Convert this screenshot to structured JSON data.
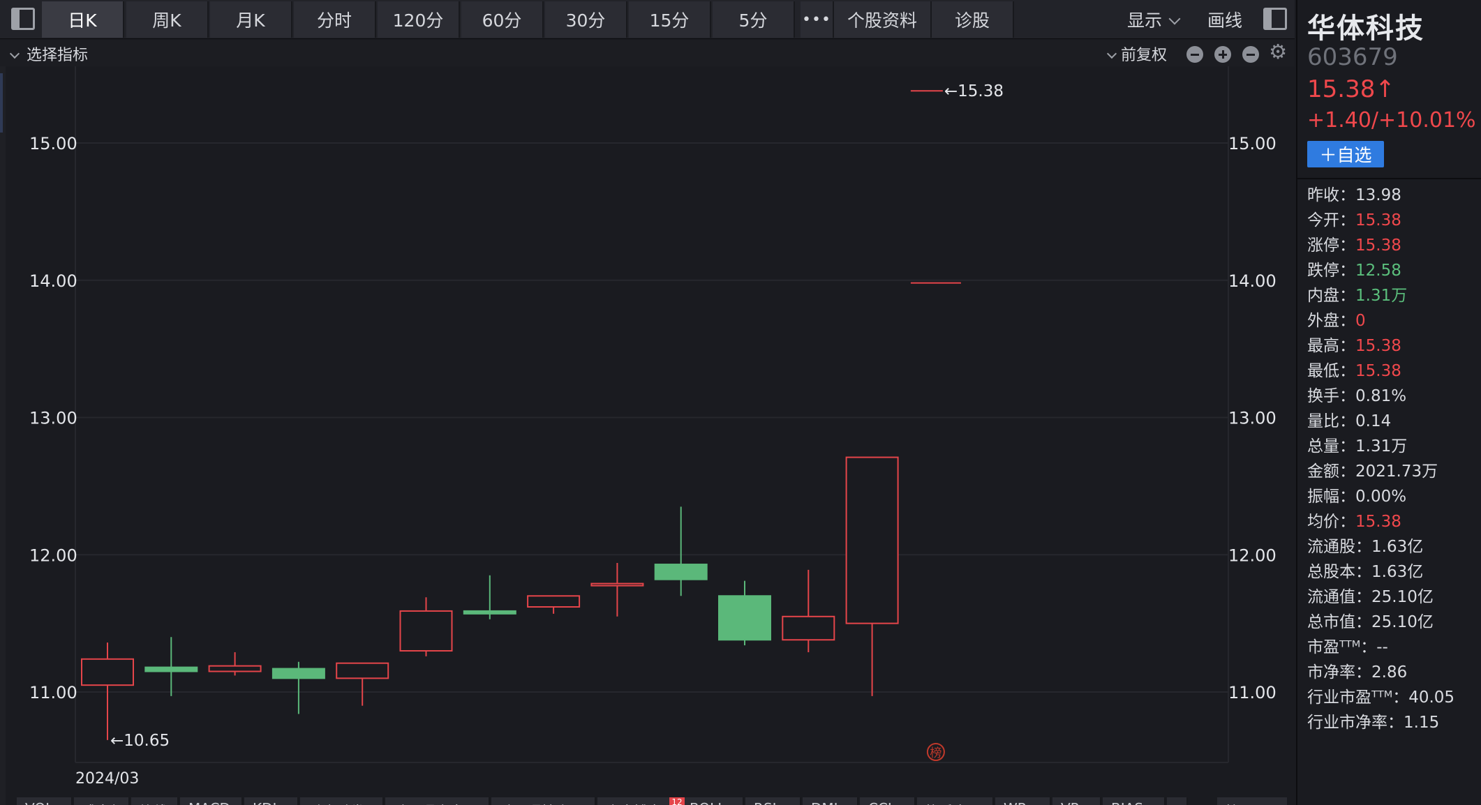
{
  "toolbar": {
    "periods": [
      {
        "label": "日K",
        "active": true
      },
      {
        "label": "周K",
        "active": false
      },
      {
        "label": "月K",
        "active": false
      },
      {
        "label": "分时",
        "active": false
      },
      {
        "label": "120分",
        "active": false
      },
      {
        "label": "60分",
        "active": false
      },
      {
        "label": "30分",
        "active": false
      },
      {
        "label": "15分",
        "active": false
      },
      {
        "label": "5分",
        "active": false
      }
    ],
    "more_label": "•••",
    "profile_label": "个股资料",
    "diagnose_label": "诊股",
    "display_label": "显示",
    "draw_line_label": "画线"
  },
  "indicator_bar": {
    "select_label": "选择指标",
    "adjust_label": "前复权"
  },
  "chart_data": {
    "type": "candlestick",
    "date_label": "2024/03",
    "y_ticks": [
      "15.00",
      "14.00",
      "13.00",
      "12.00",
      "11.00"
    ],
    "ylim": [
      10.45,
      15.5
    ],
    "grid": true,
    "candles": [
      {
        "open": 11.05,
        "high": 11.36,
        "low": 10.65,
        "close": 11.24
      },
      {
        "open": 11.18,
        "high": 11.4,
        "low": 10.97,
        "close": 11.15
      },
      {
        "open": 11.15,
        "high": 11.29,
        "low": 11.12,
        "close": 11.19
      },
      {
        "open": 11.17,
        "high": 11.22,
        "low": 10.84,
        "close": 11.1
      },
      {
        "open": 11.1,
        "high": 11.21,
        "low": 10.9,
        "close": 11.21
      },
      {
        "open": 11.3,
        "high": 11.69,
        "low": 11.26,
        "close": 11.59
      },
      {
        "open": 11.59,
        "high": 11.85,
        "low": 11.53,
        "close": 11.57
      },
      {
        "open": 11.62,
        "high": 11.7,
        "low": 11.57,
        "close": 11.7
      },
      {
        "open": 11.79,
        "high": 11.94,
        "low": 11.55,
        "close": 11.79
      },
      {
        "open": 11.93,
        "high": 12.35,
        "low": 11.7,
        "close": 11.82
      },
      {
        "open": 11.7,
        "high": 11.81,
        "low": 11.34,
        "close": 11.38
      },
      {
        "open": 11.38,
        "high": 11.89,
        "low": 11.29,
        "close": 11.55
      },
      {
        "open": 11.5,
        "high": 12.71,
        "low": 10.97,
        "close": 12.71
      },
      {
        "open": 13.98,
        "high": 13.98,
        "low": 13.98,
        "close": 13.98
      }
    ],
    "max_annotation": "←15.38",
    "min_annotation": "←10.65",
    "max_value": 15.38,
    "min_value": 10.65,
    "badge": "榜",
    "colors": {
      "up": "#e5454a",
      "down": "#5bb87a",
      "grid": "#26272d",
      "axis_text": "#e4e6ea"
    }
  },
  "bottom_tabs": [
    "VOL",
    "成交额",
    "均线",
    "MACD",
    "KDJ",
    "融资融券",
    "陆股通资金",
    "陆股通持仓",
    "资金博弈",
    "BOLL",
    "RSI",
    "DMI",
    "CCI",
    "换手率",
    "WR",
    "VR",
    "BIAS",
    "",
    "管理"
  ],
  "bottom_badge": "12",
  "quote": {
    "name": "华体科技",
    "code": "603679",
    "price": "15.38↑",
    "change": "+1.40/+10.01%",
    "watchlist_label": "＋自选",
    "rows": [
      {
        "label": "昨收：",
        "value": "13.98",
        "color": "neutral"
      },
      {
        "label": "今开：",
        "value": "15.38",
        "color": "red"
      },
      {
        "label": "涨停：",
        "value": "15.38",
        "color": "red"
      },
      {
        "label": "跌停：",
        "value": "12.58",
        "color": "green"
      },
      {
        "label": "内盘：",
        "value": "1.31万",
        "color": "green"
      },
      {
        "label": "外盘：",
        "value": "0",
        "color": "red"
      },
      {
        "label": "最高：",
        "value": "15.38",
        "color": "red"
      },
      {
        "label": "最低：",
        "value": "15.38",
        "color": "red"
      },
      {
        "label": "换手：",
        "value": "0.81%",
        "color": "neutral"
      },
      {
        "label": "量比：",
        "value": "0.14",
        "color": "neutral"
      },
      {
        "label": "总量：",
        "value": "1.31万",
        "color": "neutral"
      },
      {
        "label": "金额：",
        "value": "2021.73万",
        "color": "neutral"
      },
      {
        "label": "振幅：",
        "value": "0.00%",
        "color": "neutral"
      },
      {
        "label": "均价：",
        "value": "15.38",
        "color": "red"
      },
      {
        "label": "流通股：",
        "value": "1.63亿",
        "color": "neutral"
      },
      {
        "label": "总股本：",
        "value": "1.63亿",
        "color": "neutral"
      },
      {
        "label": "流通值：",
        "value": "25.10亿",
        "color": "neutral"
      },
      {
        "label": "总市值：",
        "value": "25.10亿",
        "color": "neutral"
      },
      {
        "label": "市盈ᵀᵀᴹ：",
        "value": "--",
        "color": "neutral"
      },
      {
        "label": "市净率：",
        "value": "2.86",
        "color": "neutral"
      },
      {
        "label": "行业市盈ᵀᵀᴹ：",
        "value": "40.05",
        "color": "neutral"
      },
      {
        "label": "行业市净率：",
        "value": "1.15",
        "color": "neutral"
      }
    ]
  }
}
